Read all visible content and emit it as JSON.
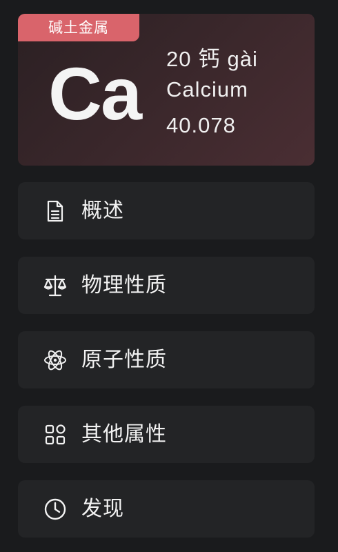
{
  "element": {
    "category": "碱土金属",
    "symbol": "Ca",
    "number": "20",
    "chinese_name": "钙",
    "pinyin": "gài",
    "english_name": "Calcium",
    "atomic_mass": "40.078"
  },
  "colors": {
    "badge": "#d9646b",
    "card_gradient_start": "#2b2023",
    "card_gradient_end": "#4a2e33",
    "menu_background": "#232426",
    "page_background": "#1a1b1d"
  },
  "menu": [
    {
      "label": "概述",
      "icon": "document-icon"
    },
    {
      "label": "物理性质",
      "icon": "scale-icon"
    },
    {
      "label": "原子性质",
      "icon": "atom-icon"
    },
    {
      "label": "其他属性",
      "icon": "grid-icon"
    },
    {
      "label": "发现",
      "icon": "clock-icon"
    }
  ]
}
